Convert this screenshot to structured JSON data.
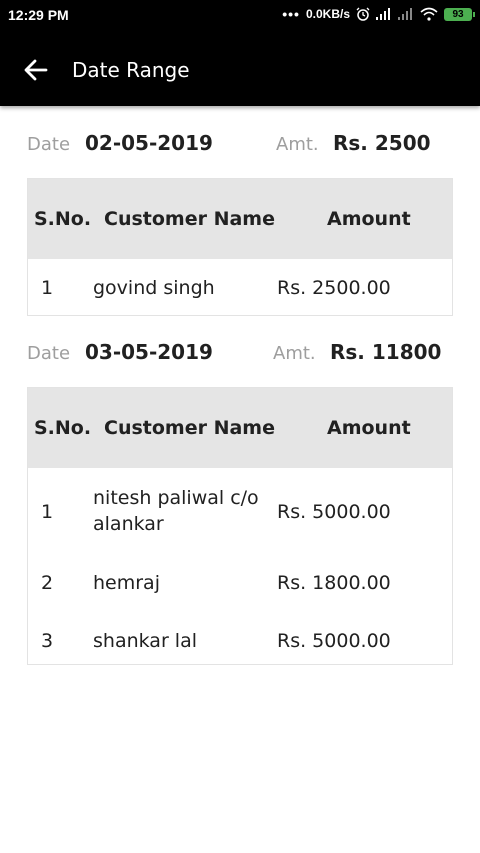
{
  "status_bar": {
    "time": "12:29 PM",
    "network_speed": "0.0KB/s",
    "battery": "93",
    "icons": [
      "alarm-icon",
      "signal-icon",
      "signal-weak-icon",
      "wifi-icon",
      "battery-icon"
    ]
  },
  "app_bar": {
    "title": "Date Range",
    "back_icon": "arrow-left-icon"
  },
  "table_headers": {
    "sno": "S.No.",
    "customer_name": "Customer Name",
    "amount": "Amount"
  },
  "groups": [
    {
      "date_label": "Date",
      "date": "02-05-2019",
      "amt_label": "Amt.",
      "amt": "Rs. 2500",
      "rows": [
        {
          "sno": "1",
          "customer_name": "govind singh",
          "amount": "Rs. 2500.00"
        }
      ]
    },
    {
      "date_label": "Date",
      "date": "03-05-2019",
      "amt_label": "Amt.",
      "amt": "Rs. 11800",
      "rows": [
        {
          "sno": "1",
          "customer_name": "nitesh paliwal c/o alankar",
          "amount": "Rs. 5000.00"
        },
        {
          "sno": "2",
          "customer_name": "hemraj",
          "amount": "Rs. 1800.00"
        },
        {
          "sno": "3",
          "customer_name": "shankar lal",
          "amount": "Rs. 5000.00"
        }
      ]
    }
  ],
  "colors": {
    "app_bar": "#000000",
    "header_row": "#e5e5e5",
    "muted_label": "#9e9e9e",
    "battery": "#4caf50"
  }
}
